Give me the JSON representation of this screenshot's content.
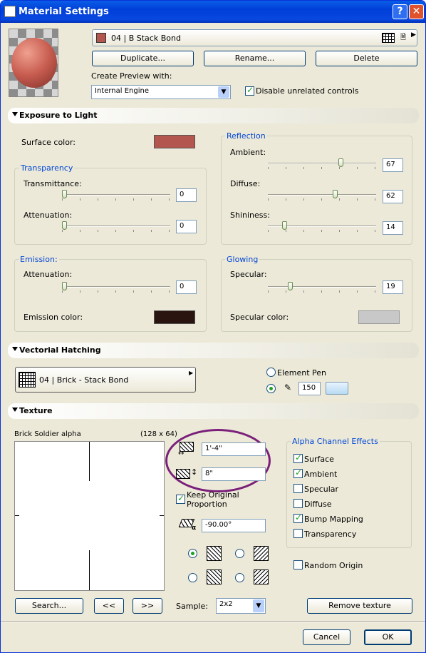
{
  "window": {
    "title": "Material Settings"
  },
  "header": {
    "material_name": "04 | B Stack Bond",
    "duplicate": "Duplicate...",
    "rename": "Rename...",
    "delete": "Delete",
    "preview_label": "Create Preview with:",
    "preview_engine": "Internal Engine",
    "disable_unrelated": "Disable unrelated controls",
    "disable_unrelated_checked": true
  },
  "exposure": {
    "title": "Exposure to Light",
    "surface_color_label": "Surface color:",
    "surface_color": "#b3574e",
    "transparency": {
      "label": "Transparency",
      "transmittance_label": "Transmittance:",
      "transmittance": "0",
      "attenuation_label": "Attenuation:",
      "attenuation": "0"
    },
    "reflection": {
      "label": "Reflection",
      "ambient_label": "Ambient:",
      "ambient": "67",
      "diffuse_label": "Diffuse:",
      "diffuse": "62",
      "shininess_label": "Shininess:",
      "shininess": "14"
    },
    "emission": {
      "label": "Emission:",
      "attenuation_label": "Attenuation:",
      "attenuation": "0",
      "color_label": "Emission color:",
      "color": "#2a1410"
    },
    "glowing": {
      "label": "Glowing",
      "specular_label": "Specular:",
      "specular": "19",
      "color_label": "Specular color:",
      "color": "#c8c8c8"
    }
  },
  "hatching": {
    "title": "Vectorial Hatching",
    "fill_name": "04 | Brick - Stack Bond",
    "element_pen": "Element Pen",
    "pen_value": "150"
  },
  "texture": {
    "title": "Texture",
    "name": "Brick Soldier alpha",
    "size": "(128 x 64)",
    "width": "1'-4\"",
    "height": "8\"",
    "keep_proportion": "Keep Original Proportion",
    "keep_proportion_checked": true,
    "angle": "-90.00°",
    "alpha": {
      "label": "Alpha Channel Effects",
      "items": [
        {
          "label": "Surface",
          "checked": true
        },
        {
          "label": "Ambient",
          "checked": true
        },
        {
          "label": "Specular",
          "checked": false
        },
        {
          "label": "Diffuse",
          "checked": false
        },
        {
          "label": "Bump Mapping",
          "checked": true
        },
        {
          "label": "Transparency",
          "checked": false
        }
      ]
    },
    "random_origin": "Random Origin",
    "search": "Search...",
    "prev": "<<",
    "next": ">>",
    "sample_label": "Sample:",
    "sample_value": "2x2",
    "remove": "Remove texture"
  },
  "footer": {
    "cancel": "Cancel",
    "ok": "OK"
  },
  "colors": {
    "brick": "#c0686a",
    "accent": "#0046d5"
  }
}
